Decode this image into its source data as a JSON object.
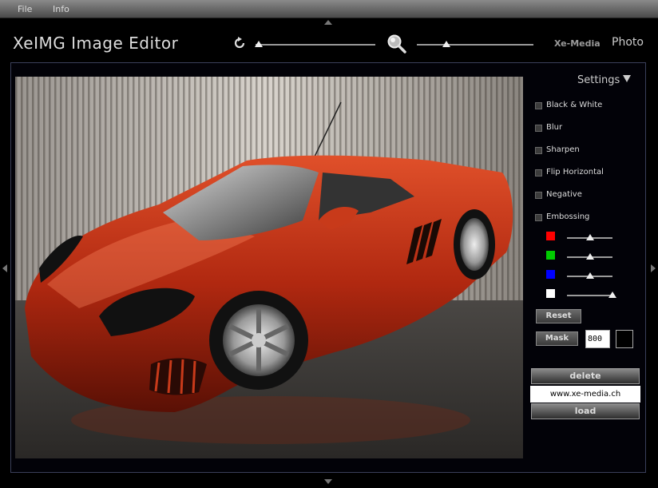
{
  "menu": {
    "file": "File",
    "info": "Info"
  },
  "header": {
    "title": "XeIMG Image Editor",
    "brand": "Xe-Media",
    "photo_link": "Photo",
    "rotate_level": 0.0,
    "zoom_level": 0.25
  },
  "icons": {
    "rotate": "rotate-icon",
    "zoom": "magnifier-icon",
    "settings": "triangle-down-icon"
  },
  "settings": {
    "label": "Settings",
    "options": [
      {
        "label": "Black & White",
        "checked": false
      },
      {
        "label": "Blur",
        "checked": false
      },
      {
        "label": "Sharpen",
        "checked": false
      },
      {
        "label": "Flip Horizontal",
        "checked": false
      },
      {
        "label": "Negative",
        "checked": false
      },
      {
        "label": "Embossing",
        "checked": false
      }
    ],
    "color_sliders": [
      {
        "color": "#ff0000",
        "level": 0.5
      },
      {
        "color": "#00cc00",
        "level": 0.5
      },
      {
        "color": "#0000ff",
        "level": 0.5
      },
      {
        "color": "#ffffff",
        "level": 1.0
      }
    ],
    "reset_label": "Reset",
    "mask_label": "Mask",
    "mask_value": "800"
  },
  "actions": {
    "delete_label": "delete",
    "url_value": "www.xe-media.ch",
    "load_label": "load"
  }
}
